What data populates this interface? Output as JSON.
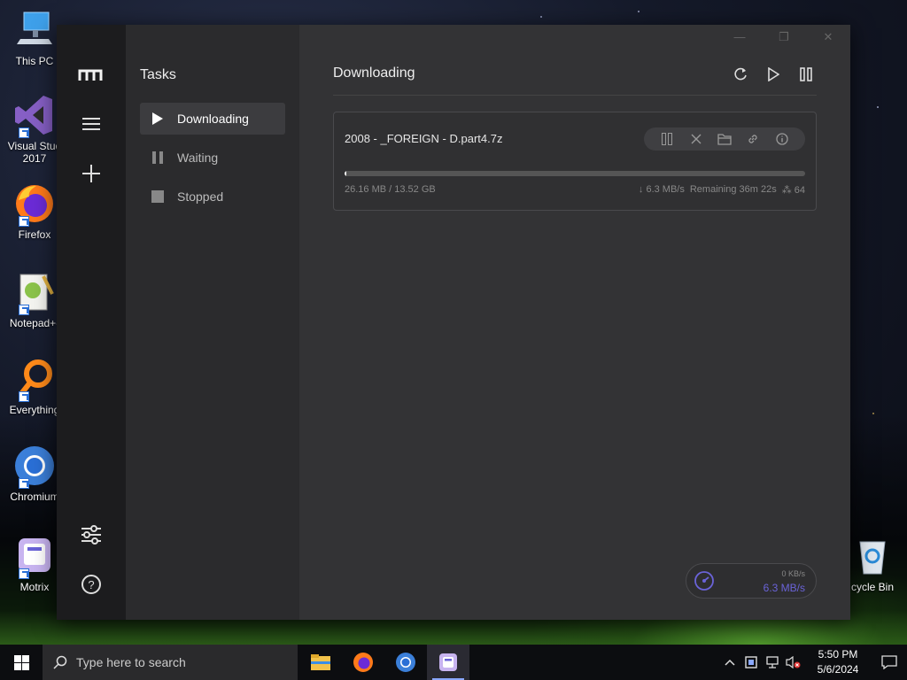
{
  "desktop": {
    "icons": [
      {
        "label": "This PC",
        "icon": "computer-icon"
      },
      {
        "label": "Visual Stud 2017",
        "icon": "visual-studio-icon"
      },
      {
        "label": "Firefox",
        "icon": "firefox-icon"
      },
      {
        "label": "Notepad+-",
        "icon": "notepad-plus-icon"
      },
      {
        "label": "Everything",
        "icon": "everything-search-icon"
      },
      {
        "label": "Chromium",
        "icon": "chromium-icon"
      },
      {
        "label": "Motrix",
        "icon": "motrix-icon"
      },
      {
        "label": "cycle Bin",
        "icon": "recycle-bin-icon"
      }
    ]
  },
  "app": {
    "sidebar": {
      "title": "Tasks",
      "items": [
        {
          "label": "Downloading",
          "icon": "play-icon",
          "active": true
        },
        {
          "label": "Waiting",
          "icon": "pause-icon",
          "active": false
        },
        {
          "label": "Stopped",
          "icon": "stop-icon",
          "active": false
        }
      ]
    },
    "main": {
      "title": "Downloading",
      "task": {
        "name": "2008 - _FOREIGN - D.part4.7z",
        "size": "26.16 MB / 13.52 GB",
        "speed": "↓ 6.3 MB/s",
        "remaining": "Remaining 36m 22s",
        "connections": "⁂ 64",
        "progress": 0.0019
      }
    },
    "speedometer": {
      "upload": "0 KB/s",
      "download": "6.3 MB/s"
    },
    "colors": {
      "accent": "#6a63d8"
    }
  },
  "taskbar": {
    "search_placeholder": "Type here to search",
    "time": "5:50 PM",
    "date": "5/6/2024"
  }
}
